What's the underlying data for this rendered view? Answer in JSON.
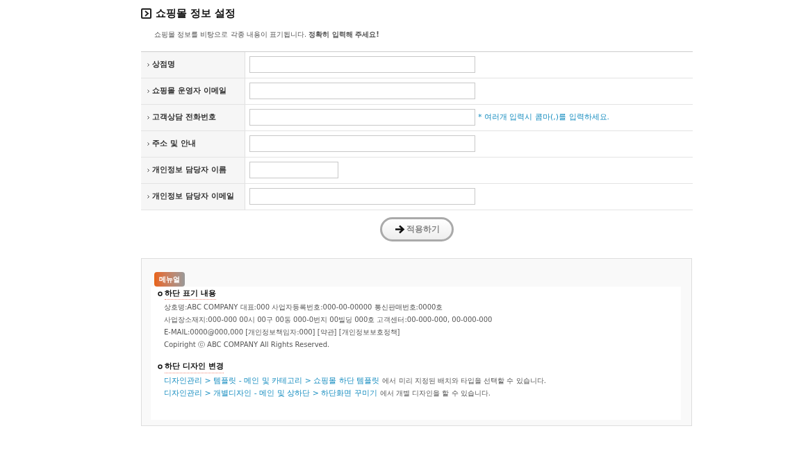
{
  "title": "쇼핑몰 정보 설정",
  "description": "쇼핑몰 정보를 비탕으로 각종 내용이 표기됩니다. **정확히 입력해 주세요!**",
  "fields": [
    {
      "label": "상점명",
      "kind": "wide"
    },
    {
      "label": "쇼핑몰 운영자 이메일",
      "kind": "wide"
    },
    {
      "label": "고객상담 전화번호",
      "kind": "wide",
      "hint": "* 여러개 입력시 콤마(,)를 입력하세요."
    },
    {
      "label": "주소 및 안내",
      "kind": "wide"
    },
    {
      "label": "개인정보 담당자 이름",
      "kind": "short"
    },
    {
      "label": "개인정보 담당자 이메일",
      "kind": "wide"
    }
  ],
  "apply_button": "적용하기",
  "manual": {
    "badge": "메뉴얼",
    "sections": [
      {
        "heading": "하단 표기 내용",
        "lines": [
          {
            "text": "상호명:ABC COMPANY  대표:000  사업자등록번호:000-00-00000  통신판매번호:0000호"
          },
          {
            "text": "사업장소재지:000-000  00시 00구 00동 000-0번지 00빌딩 000호  고객센터:00-000-000, 00-000-000"
          },
          {
            "text": "E-MAIL:0000@000,000  [개인정보책임자:000]  [약관]  [개인정보보호정책]"
          },
          {
            "text": "Copiright ⓒ ABC COMPANY All Rights Reserved."
          }
        ]
      },
      {
        "heading": "하단 디자인 변경",
        "lines": [
          {
            "link": "디자인관리 > 템플릿 - 메인 및 카테고리 > 쇼핑몰 하단 템플릿",
            "text": "에서 미리 지정된 배치와 타입을 선택할 수 있습니다."
          },
          {
            "link": "디자인관리 > 개별디자인 - 메인 및 상하단 > 하단화면 꾸미기",
            "text": "에서 개별 디자인을 할 수 있습니다."
          }
        ]
      }
    ]
  }
}
